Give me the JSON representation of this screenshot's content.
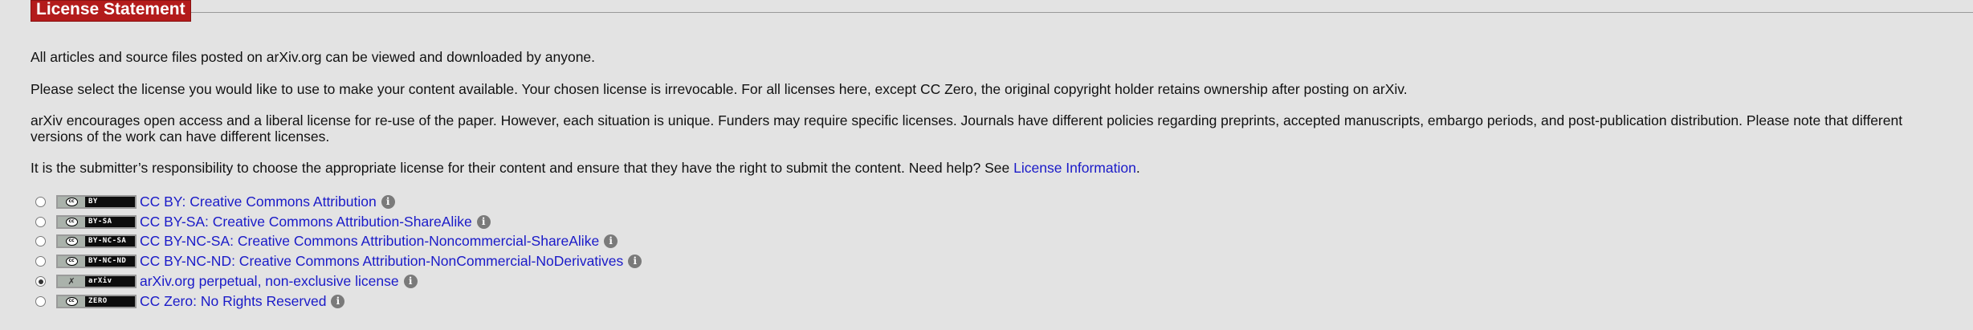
{
  "section": {
    "title": "License Statement"
  },
  "paragraphs": {
    "p1": "All articles and source files posted on arXiv.org can be viewed and downloaded by anyone.",
    "p2": "Please select the license you would like to use to make your content available. Your chosen license is irrevocable. For all licenses here, except CC Zero, the original copyright holder retains ownership after posting on arXiv.",
    "p3": "arXiv encourages open access and a liberal license for re-use of the paper. However, each situation is unique. Funders may require specific licenses. Journals have different policies regarding preprints, accepted manuscripts, embargo periods, and post-publication distribution. Please note that different versions of the work can have different licenses.",
    "p4_prefix": "It is the submitter’s responsibility to choose the appropriate license for their content and ensure that they have the right to submit the content. Need help? See ",
    "p4_link": "License Information",
    "p4_suffix": "."
  },
  "licenses": [
    {
      "badge_left": "cc",
      "badge_text": "BY",
      "label": "CC BY: Creative Commons Attribution",
      "selected": false,
      "info_icon": "info-icon"
    },
    {
      "badge_left": "cc",
      "badge_text": "BY-SA",
      "label": "CC BY-SA: Creative Commons Attribution-ShareAlike",
      "selected": false,
      "info_icon": "info-icon"
    },
    {
      "badge_left": "cc",
      "badge_text": "BY-NC-SA",
      "label": "CC BY-NC-SA: Creative Commons Attribution-Noncommercial-ShareAlike",
      "selected": false,
      "info_icon": "info-icon"
    },
    {
      "badge_left": "cc",
      "badge_text": "BY-NC-ND",
      "label": "CC BY-NC-ND: Creative Commons Attribution-NonCommercial-NoDerivatives",
      "selected": false,
      "info_icon": "info-icon"
    },
    {
      "badge_left": "x",
      "badge_text": "arXiv",
      "label": "arXiv.org perpetual, non-exclusive license",
      "selected": true,
      "info_icon": "info-icon"
    },
    {
      "badge_left": "cc",
      "badge_text": "ZERO",
      "label": "CC Zero: No Rights Reserved",
      "selected": false,
      "info_icon": "info-icon"
    }
  ],
  "colors": {
    "brand_red": "#b31b1b",
    "link_blue": "#1a1ac8",
    "background": "#e3e3e3"
  }
}
